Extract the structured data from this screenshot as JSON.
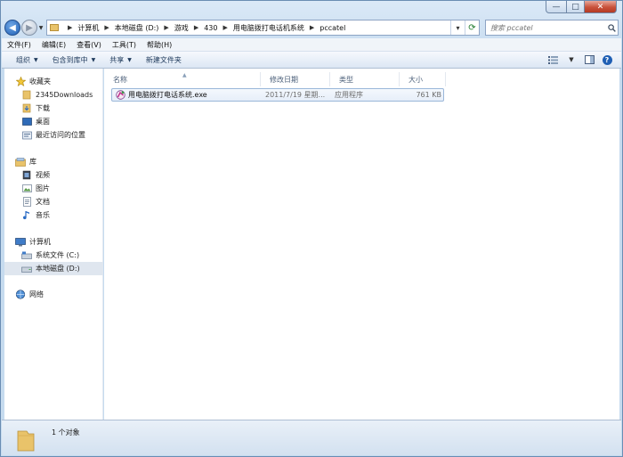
{
  "window": {
    "caption_buttons": {
      "minimize": "—",
      "maximize": "□",
      "close": "✕"
    }
  },
  "address": {
    "crumbs": [
      "计算机",
      "本地磁盘 (D:)",
      "游戏",
      "430",
      "用电脑拨打电话机系统",
      "pccatel"
    ],
    "search_placeholder": "搜索 pccatel"
  },
  "menu": [
    "文件(F)",
    "编辑(E)",
    "查看(V)",
    "工具(T)",
    "帮助(H)"
  ],
  "toolbar": {
    "organize": "组织",
    "include_in_library": "包含到库中",
    "share": "共享",
    "new_folder": "新建文件夹"
  },
  "nav": {
    "favorites": {
      "label": "收藏夹",
      "items": [
        "2345Downloads",
        "下载",
        "桌面",
        "最近访问的位置"
      ]
    },
    "libraries": {
      "label": "库",
      "items": [
        "视频",
        "图片",
        "文档",
        "音乐"
      ]
    },
    "computer": {
      "label": "计算机",
      "items": [
        "系统文件 (C:)",
        "本地磁盘 (D:)"
      ],
      "selected": "本地磁盘 (D:)"
    },
    "network": {
      "label": "网络"
    }
  },
  "columns": [
    "名称",
    "修改日期",
    "类型",
    "大小"
  ],
  "files": [
    {
      "name": "用电脑拨打电话系统.exe",
      "date": "2011/7/19 星期...",
      "type": "应用程序",
      "size": "761 KB"
    }
  ],
  "status": {
    "count_text": "1 个对象"
  },
  "colors": {
    "accent": "#1f5fb4",
    "selection": "#dfe6ef",
    "folder": "#e9c36a"
  }
}
